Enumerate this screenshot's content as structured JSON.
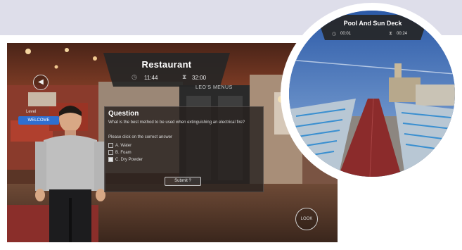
{
  "colors": {
    "top_band": "#dedeea",
    "hud_bg": "#262626",
    "accent_blue": "#2f6fd0",
    "track_red": "#8b2b2b"
  },
  "main_scene": {
    "location_title": "Restaurant",
    "time_elapsed": "11:44",
    "time_remaining": "32:00",
    "clock_icon": "clock-icon",
    "hourglass_icon": "hourglass-icon",
    "sign_text": "LEO'S MENUS",
    "side_label": "Level",
    "side_button": "WELCOME",
    "quiz": {
      "title": "Question",
      "text": "What is the best method to be used when extinguishing an electrical fire?",
      "prompt": "Please click on the correct answer",
      "options": [
        {
          "label": "A. Water",
          "checked": false
        },
        {
          "label": "B. Foam",
          "checked": false
        },
        {
          "label": "C. Dry Powder",
          "checked": true
        }
      ],
      "submit_label": "Submit ?"
    },
    "nav_right_label": "LOOK"
  },
  "inset_scene": {
    "location_title": "Pool And Sun Deck",
    "time_elapsed": "00:01",
    "time_remaining": "00:24"
  }
}
